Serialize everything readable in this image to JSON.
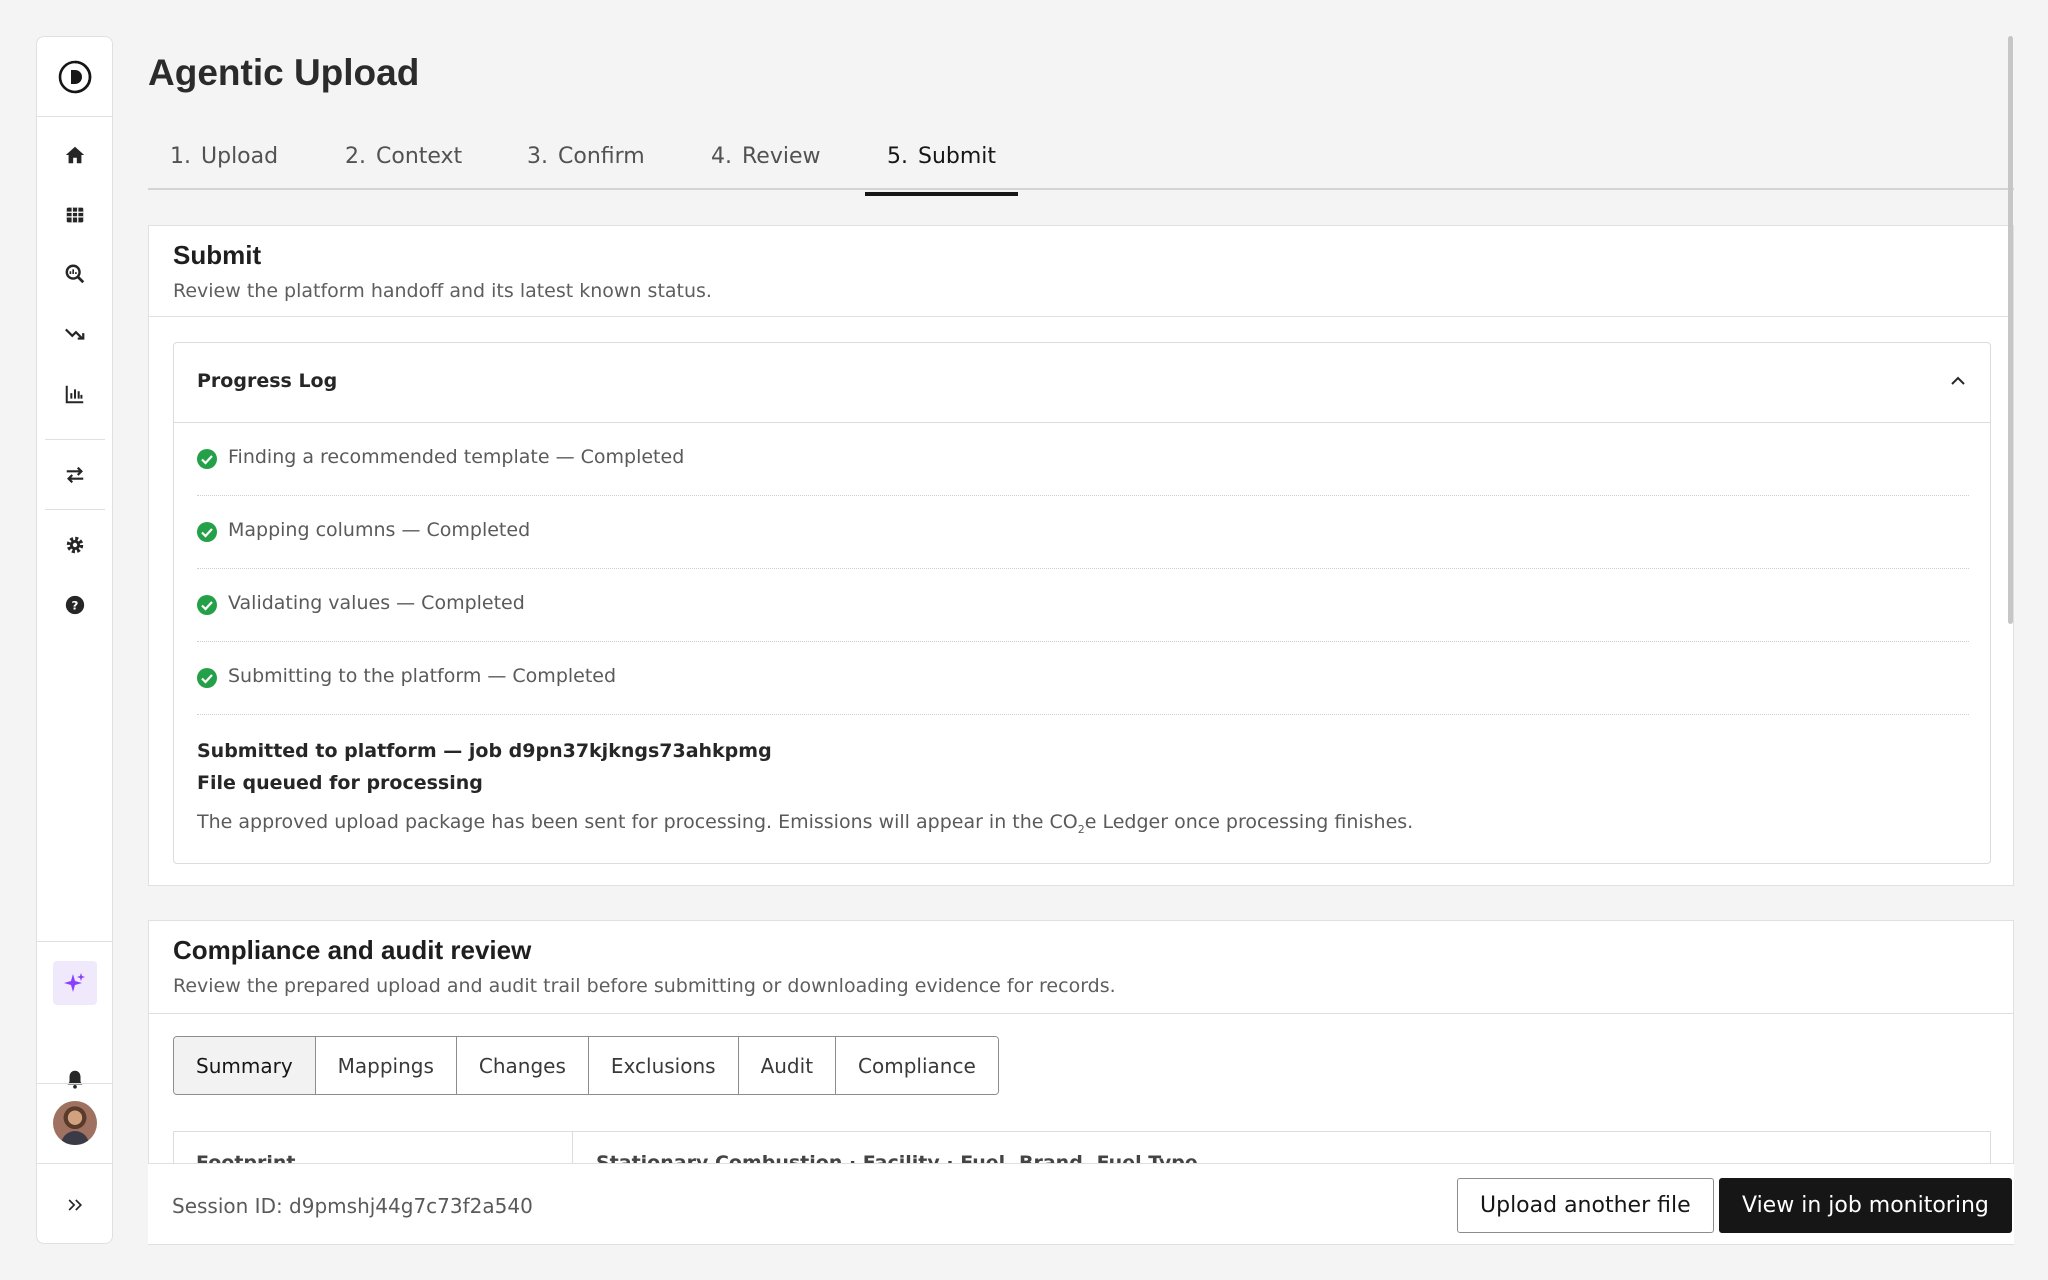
{
  "page": {
    "title": "Agentic Upload"
  },
  "sidebar": {
    "icons": [
      "logo-icon",
      "home-icon",
      "table-icon",
      "search-analytics-icon",
      "trend-down-icon",
      "bar-chart-icon",
      "transfer-icon",
      "settings-icon",
      "help-icon",
      "ai-sparkle-icon",
      "bell-icon",
      "avatar",
      "expand-icon"
    ]
  },
  "steps": [
    {
      "num": "1.",
      "label": "Upload"
    },
    {
      "num": "2.",
      "label": "Context"
    },
    {
      "num": "3.",
      "label": "Confirm"
    },
    {
      "num": "4.",
      "label": "Review"
    },
    {
      "num": "5.",
      "label": "Submit"
    }
  ],
  "submit": {
    "title": "Submit",
    "subtitle": "Review the platform handoff and its latest known status.",
    "log": {
      "title": "Progress Log",
      "items": [
        "Finding a recommended template — Completed",
        "Mapping columns — Completed",
        "Validating values — Completed",
        "Submitting to the platform — Completed"
      ],
      "submitted_line": "Submitted to platform — job d9pn37kjkngs73ahkpmg",
      "queued_line": "File queued for processing",
      "body_before": "The approved upload package has been sent for processing. Emissions will appear in the CO",
      "body_sub": "2",
      "body_after": "e Ledger once processing finishes."
    }
  },
  "compliance": {
    "title": "Compliance and audit review",
    "subtitle": "Review the prepared upload and audit trail before submitting or downloading evidence for records.",
    "tabs": [
      "Summary",
      "Mappings",
      "Changes",
      "Exclusions",
      "Audit",
      "Compliance"
    ],
    "summary_left": "Footprint",
    "summary_right": "Stationary Combustion · Facility · Fuel, Brand, Fuel Type"
  },
  "footer": {
    "session": "Session ID: d9pmshj44g7c73f2a540",
    "upload_another": "Upload another file",
    "view_monitoring": "View in job monitoring"
  },
  "colors": {
    "success": "#24a148",
    "accent": "#161616",
    "ai_bg": "#efe9fb",
    "ai_icon": "#8a3ffc"
  }
}
